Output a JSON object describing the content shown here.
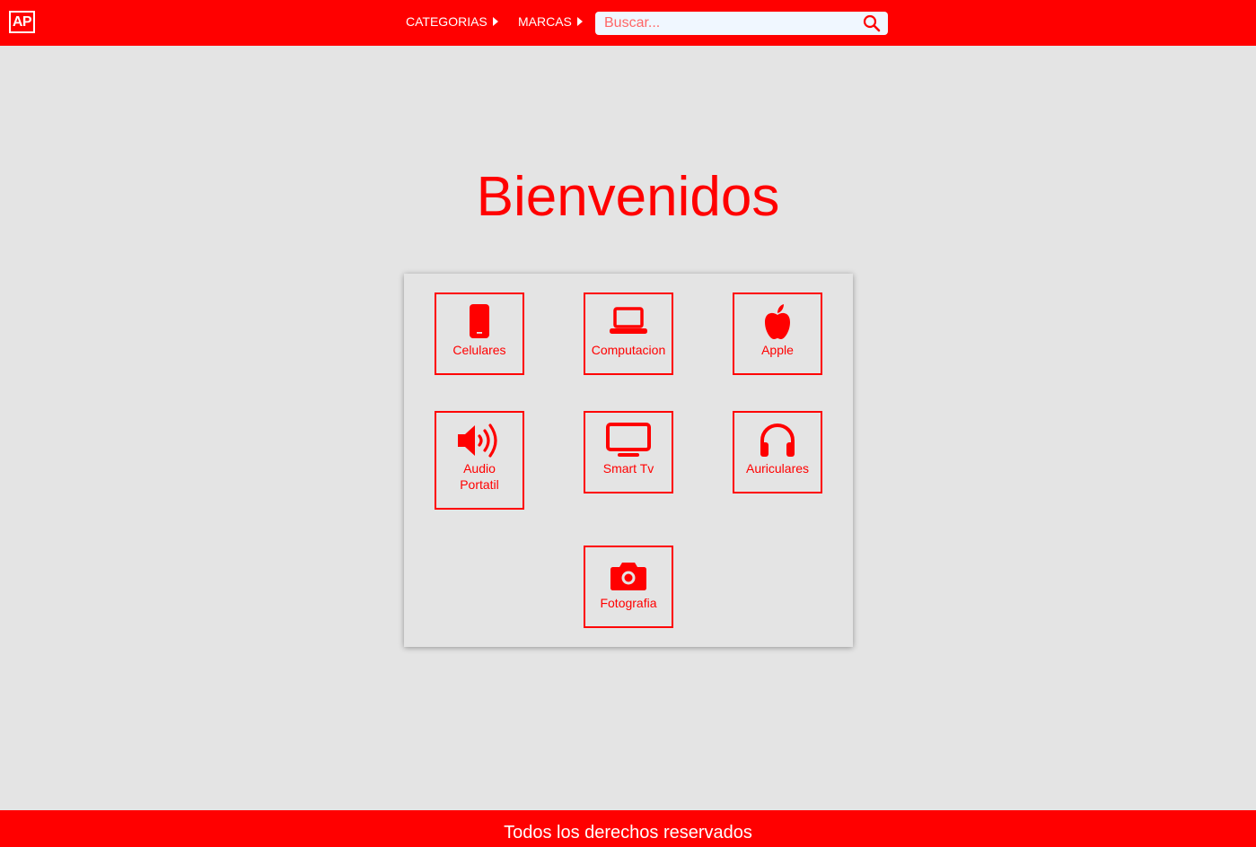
{
  "header": {
    "logo_text": "AP",
    "nav": [
      {
        "label": "CATEGORIAS"
      },
      {
        "label": "MARCAS"
      }
    ],
    "search": {
      "placeholder": "Buscar...",
      "value": ""
    }
  },
  "main": {
    "title": "Bienvenidos",
    "categories": [
      {
        "label": "Celulares",
        "icon": "mobile-phone-icon"
      },
      {
        "label": "Computacion",
        "icon": "laptop-icon"
      },
      {
        "label": "Apple",
        "icon": "apple-icon"
      },
      {
        "label": "Audio Portatil",
        "icon": "speaker-volume-icon"
      },
      {
        "label": "Smart Tv",
        "icon": "tv-icon"
      },
      {
        "label": "Auriculares",
        "icon": "headphones-icon"
      },
      {
        "label": "Fotografia",
        "icon": "camera-icon"
      }
    ]
  },
  "footer": {
    "text": "Todos los derechos reservados"
  },
  "colors": {
    "accent": "#ff0000",
    "background": "#e4e4e4",
    "header_text": "#ffffff",
    "search_bg": "#f0f7ff"
  }
}
